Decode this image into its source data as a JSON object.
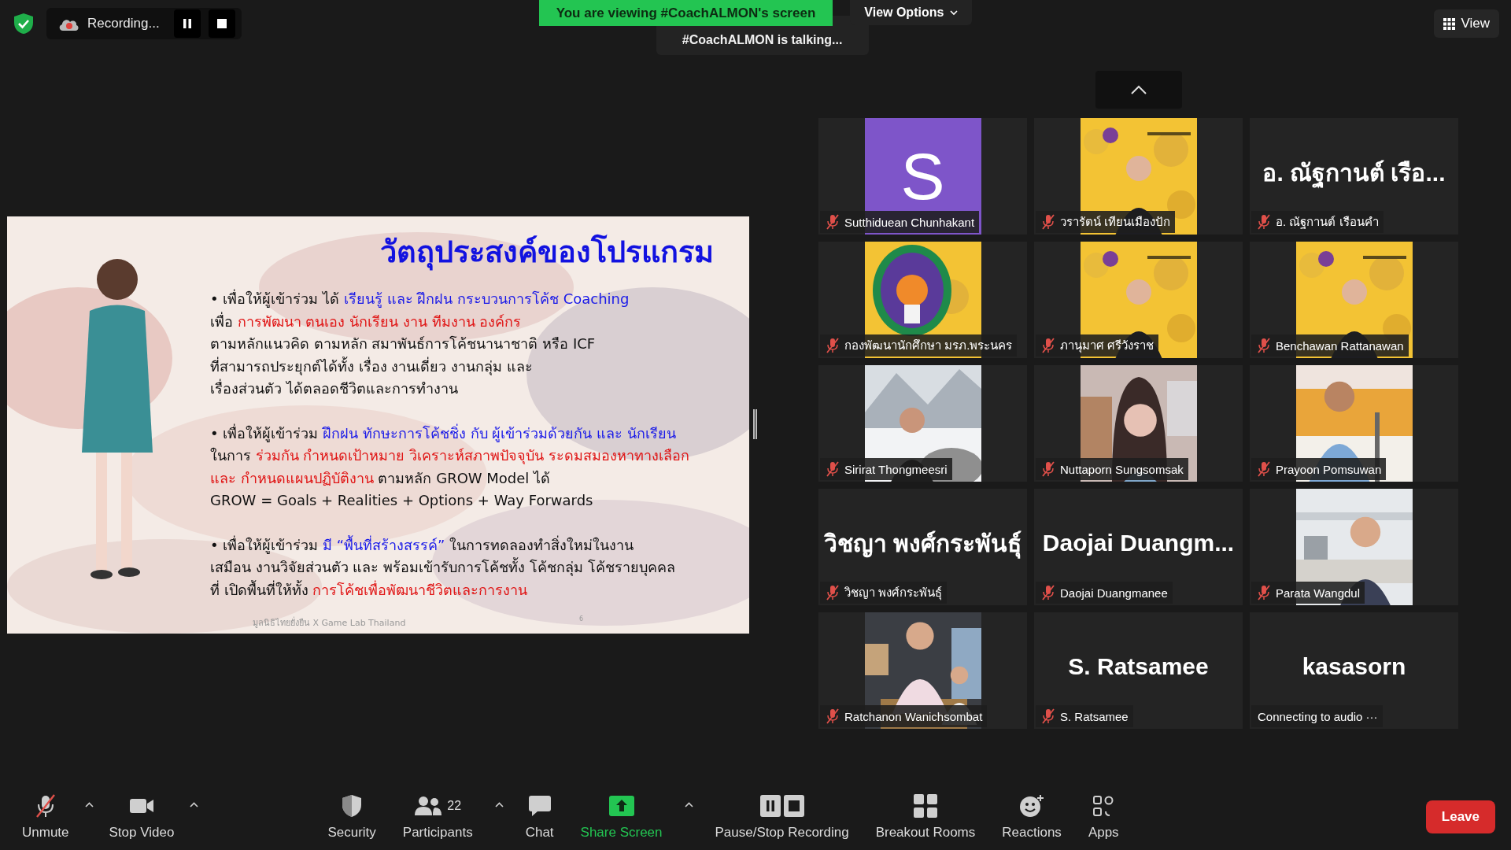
{
  "top_bar": {
    "recording_label": "Recording...",
    "share_banner": "You are viewing #CoachALMON's screen",
    "view_options": "View Options",
    "talking_indicator": "#CoachALMON is talking...",
    "view_button": "View"
  },
  "slide": {
    "title": "วัตถุประสงค์ของโปรแกรม",
    "paragraphs": [
      [
        [
          {
            "text": "• เพื่อให้ผู้เข้าร่วม ได้ ",
            "kind": "plain"
          },
          {
            "text": "เรียนรู้ และ ฝึกฝน กระบวนการโค้ช Coaching",
            "kind": "emphasis"
          }
        ],
        [
          {
            "text": "เพื่อ ",
            "kind": "plain"
          },
          {
            "text": "การพัฒนา ตนเอง นักเรียน งาน ทีมงาน องค์กร",
            "kind": "key"
          }
        ],
        [
          {
            "text": "ตามหลักแนวคิด ตามหลัก สมาพันธ์การโค้ชนานาชาติ หรือ ICF",
            "kind": "plain"
          }
        ],
        [
          {
            "text": "ที่สามารถประยุกต์ได้ทั้ง เรื่อง งานเดี่ยว งานกลุ่ม และ",
            "kind": "plain"
          }
        ],
        [
          {
            "text": "เรื่องส่วนตัว ได้ตลอดชีวิตและการทำงาน",
            "kind": "plain"
          }
        ]
      ],
      [
        [
          {
            "text": "• เพื่อให้ผู้เข้าร่วม ",
            "kind": "plain"
          },
          {
            "text": "ฝึกฝน ทักษะการโค้ชชิ่ง กับ ผู้เข้าร่วมด้วยกัน และ นักเรียน",
            "kind": "emphasis"
          }
        ],
        [
          {
            "text": "ในการ ",
            "kind": "plain"
          },
          {
            "text": "ร่วมกัน กำหนดเป้าหมาย วิเคราะห์สภาพปัจจุบัน ระดมสมองหาทางเลือก",
            "kind": "key"
          }
        ],
        [
          {
            "text": "และ กำหนดแผนปฏิบัติงาน",
            "kind": "key"
          },
          {
            "text": " ตามหลัก GROW Model ได้",
            "kind": "plain"
          }
        ],
        [
          {
            "text": "GROW = Goals + Realities + Options + Way Forwards",
            "kind": "plain"
          }
        ]
      ],
      [
        [
          {
            "text": "• เพื่อให้ผู้เข้าร่วม ",
            "kind": "plain"
          },
          {
            "text": "มี “พื้นที่สร้างสรรค์”",
            "kind": "emphasis"
          },
          {
            "text": " ในการทดลองทำสิ่งใหม่ในงาน",
            "kind": "plain"
          }
        ],
        [
          {
            "text": "เสมือน งานวิจัยส่วนตัว และ พร้อมเข้ารับการโค้ชทั้ง โค้ชกลุ่ม โค้ชรายบุคคล",
            "kind": "plain"
          }
        ],
        [
          {
            "text": "ที่ เปิดพื้นที่ให้ทั้ง ",
            "kind": "plain"
          },
          {
            "text": "การโค้ชเพื่อพัฒนาชีวิตและการงาน",
            "kind": "key"
          }
        ]
      ]
    ],
    "footer": "มูลนิธิไทยยั่งยืน X Game Lab Thailand",
    "page_number": "6"
  },
  "gallery": {
    "tiles": [
      {
        "kind": "avatar",
        "initial": "S",
        "label": "Sutthiduean Chunhakant",
        "muted": true
      },
      {
        "kind": "picture",
        "label": "วรารัตน์ เทียนเมืองปัก",
        "muted": true
      },
      {
        "kind": "name_only",
        "display_name": "อ. ณัฐกานต์  เรือ...",
        "label": "อ. ณัฐกานต์  เรือนคำ",
        "muted": true
      },
      {
        "kind": "picture",
        "label": "กองพัฒนานักศึกษา มรภ.พระนคร",
        "muted": true
      },
      {
        "kind": "picture",
        "label": "ภานุมาศ ศรีวังราช",
        "muted": true
      },
      {
        "kind": "picture",
        "label": "Benchawan Rattanawan",
        "muted": true
      },
      {
        "kind": "picture",
        "label": "Sirirat Thongmeesri",
        "muted": true
      },
      {
        "kind": "picture",
        "label": "Nuttaporn Sungsomsak",
        "muted": true
      },
      {
        "kind": "picture",
        "label": "Prayoon Pomsuwan",
        "muted": true
      },
      {
        "kind": "name_only",
        "display_name": "วิชญา พงศ์กระพันธุ์",
        "label": "วิชญา พงศ์กระพันธุ์",
        "muted": true
      },
      {
        "kind": "name_only",
        "display_name": "Daojai  Duangm...",
        "label": "Daojai Duangmanee",
        "muted": true
      },
      {
        "kind": "picture",
        "label": "Parata Wangdul",
        "muted": true
      },
      {
        "kind": "picture",
        "label": "Ratchanon Wanichsombat",
        "muted": true
      },
      {
        "kind": "name_only",
        "display_name": "S. Ratsamee",
        "label": "S. Ratsamee",
        "muted": true
      },
      {
        "kind": "name_only",
        "display_name": "kasasorn",
        "label": "Connecting to audio ···",
        "muted": false
      }
    ]
  },
  "toolbar": {
    "items": [
      {
        "kind": "mic",
        "label": "Unmute",
        "muted": true,
        "active": false,
        "menu": true
      },
      {
        "kind": "video",
        "label": "Stop Video",
        "active": false,
        "menu": true
      },
      {
        "kind": "security",
        "label": "Security",
        "active": false,
        "menu": false
      },
      {
        "kind": "participants",
        "label": "Participants",
        "count": "22",
        "active": false,
        "menu": true
      },
      {
        "kind": "chat",
        "label": "Chat",
        "active": false,
        "menu": false
      },
      {
        "kind": "share",
        "label": "Share Screen",
        "active": true,
        "menu": true
      },
      {
        "kind": "recording",
        "label": "Pause/Stop Recording",
        "active": false,
        "menu": false
      },
      {
        "kind": "breakout",
        "label": "Breakout Rooms",
        "active": false,
        "menu": false
      },
      {
        "kind": "reactions",
        "label": "Reactions",
        "active": false,
        "menu": false
      },
      {
        "kind": "apps",
        "label": "Apps",
        "active": false,
        "menu": false
      }
    ],
    "leave": "Leave"
  }
}
